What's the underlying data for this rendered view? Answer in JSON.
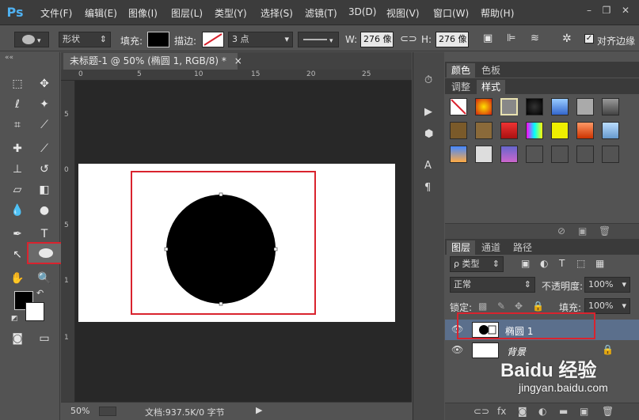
{
  "app": {
    "logo": "Ps"
  },
  "menu": [
    "文件(F)",
    "编辑(E)",
    "图像(I)",
    "图层(L)",
    "类型(Y)",
    "选择(S)",
    "滤镜(T)",
    "3D(D)",
    "视图(V)",
    "窗口(W)",
    "帮助(H)"
  ],
  "options": {
    "mode": "形状",
    "fill_label": "填充:",
    "stroke_label": "描边:",
    "stroke_size": "3 点",
    "w_label": "W:",
    "w_value": "276 像",
    "h_label": "H:",
    "h_value": "276 像",
    "align_label": "对齐边缘"
  },
  "document": {
    "tab_title": "未标题-1 @ 50% (椭圆 1, RGB/8) *",
    "ruler_top": [
      "0",
      "5",
      "10",
      "15",
      "20",
      "25"
    ],
    "ruler_left": [
      "5",
      "0",
      "5",
      "1",
      "1"
    ],
    "zoom": "50%",
    "doc_info": "文档:937.5K/0 字节"
  },
  "panels": {
    "color_tab": "颜色",
    "swatches_tab": "色板",
    "adjust_tab": "调整",
    "styles_tab": "样式",
    "layers_tab": "图层",
    "channels_tab": "通道",
    "paths_tab": "路径",
    "filter_kind": "ρ 类型",
    "blend_mode": "正常",
    "opacity_label": "不透明度:",
    "opacity_value": "100%",
    "lock_label": "锁定:",
    "fill_label": "填充:",
    "fill_value": "100%"
  },
  "layers": [
    {
      "name": "椭圆 1"
    },
    {
      "name": "背景"
    }
  ],
  "watermark": {
    "brand": "Baidu 经验",
    "url": "jingyan.baidu.com"
  },
  "colors": {
    "accent_red": "#d9232e",
    "selected_layer": "#5b6f8c"
  }
}
